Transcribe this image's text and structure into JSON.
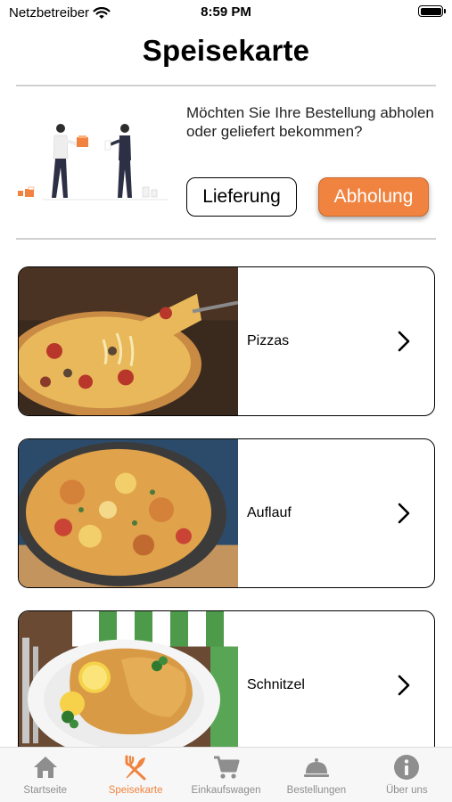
{
  "status_bar": {
    "carrier": "Netzbetreiber",
    "time": "8:59 PM"
  },
  "header": {
    "title": "Speisekarte"
  },
  "delivery": {
    "question": "Möchten Sie Ihre Bestellung abholen oder geliefert bekommen?",
    "delivery_button": "Lieferung",
    "pickup_button": "Abholung",
    "selected": "Abholung"
  },
  "categories": [
    {
      "label": "Pizzas"
    },
    {
      "label": "Auflauf"
    },
    {
      "label": "Schnitzel"
    }
  ],
  "tab_bar": {
    "active": "Speisekarte",
    "tabs": [
      {
        "label": "Startseite",
        "icon": "home-icon"
      },
      {
        "label": "Speisekarte",
        "icon": "fork-knife-icon"
      },
      {
        "label": "Einkaufswagen",
        "icon": "cart-icon"
      },
      {
        "label": "Bestellungen",
        "icon": "cloche-icon"
      },
      {
        "label": "Über uns",
        "icon": "info-icon"
      }
    ]
  },
  "colors": {
    "accent": "#f0833f",
    "inactive_tab": "#8e8e8e",
    "divider": "#d0d0d0"
  }
}
